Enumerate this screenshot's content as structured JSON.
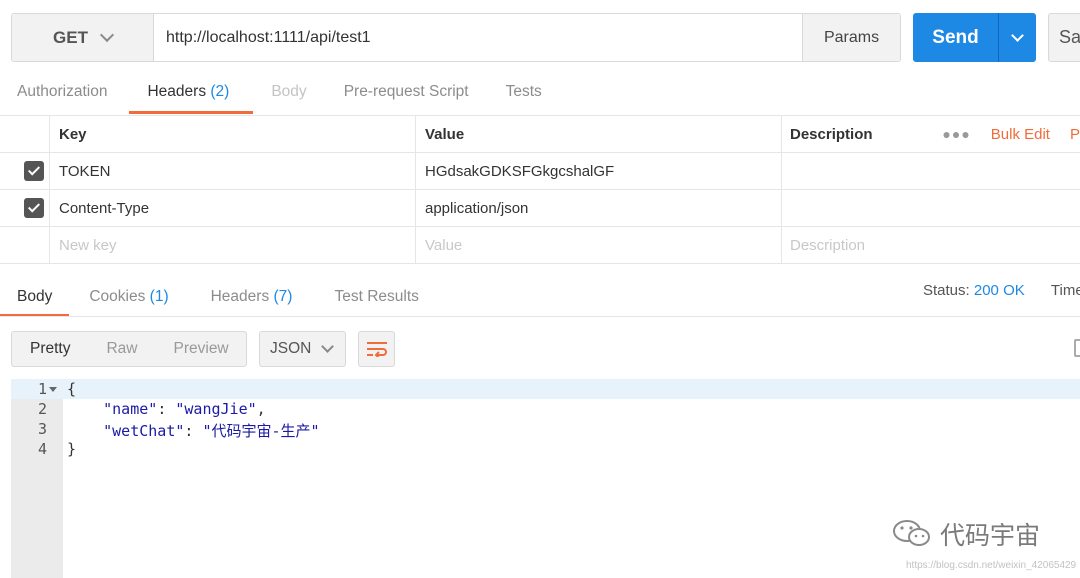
{
  "request": {
    "method": "GET",
    "url": "http://localhost:1111/api/test1",
    "params_label": "Params",
    "send_label": "Send",
    "save_label": "Sav"
  },
  "request_tabs": [
    {
      "label": "Authorization",
      "count": ""
    },
    {
      "label": "Headers",
      "count": "(2)"
    },
    {
      "label": "Body",
      "count": ""
    },
    {
      "label": "Pre-request Script",
      "count": ""
    },
    {
      "label": "Tests",
      "count": ""
    }
  ],
  "headers_table": {
    "columns": {
      "key": "Key",
      "value": "Value",
      "description": "Description"
    },
    "bulk_edit": "Bulk Edit",
    "presets": "P",
    "rows": [
      {
        "key": "TOKEN",
        "value": "HGdsakGDKSFGkgcshalGF",
        "description": "",
        "checked": true
      },
      {
        "key": "Content-Type",
        "value": "application/json",
        "description": "",
        "checked": true
      }
    ],
    "new_row": {
      "key": "New key",
      "value": "Value",
      "description": "Description"
    }
  },
  "response_tabs": [
    {
      "label": "Body",
      "count": ""
    },
    {
      "label": "Cookies",
      "count": "(1)"
    },
    {
      "label": "Headers",
      "count": "(7)"
    },
    {
      "label": "Test Results",
      "count": ""
    }
  ],
  "status": {
    "label": "Status:",
    "value": "200 OK",
    "time_label": "Time"
  },
  "view": {
    "modes": [
      "Pretty",
      "Raw",
      "Preview"
    ],
    "active_mode": "Pretty",
    "format": "JSON"
  },
  "code": {
    "lines": [
      {
        "num": "1",
        "text": "{"
      },
      {
        "num": "2",
        "key": "\"name\"",
        "value": "\"wangJie\"",
        "suffix": ","
      },
      {
        "num": "3",
        "key": "\"wetChat\"",
        "value": "\"代码宇宙-生产\"",
        "suffix": ""
      },
      {
        "num": "4",
        "text": "}"
      }
    ]
  },
  "watermark": {
    "text": "代码宇宙",
    "url": "https://blog.csdn.net/weixin_42065429"
  },
  "colors": {
    "accent": "#1e88e5",
    "tab_underline": "#f26b3a",
    "bulk_edit": "#f26b3a"
  }
}
